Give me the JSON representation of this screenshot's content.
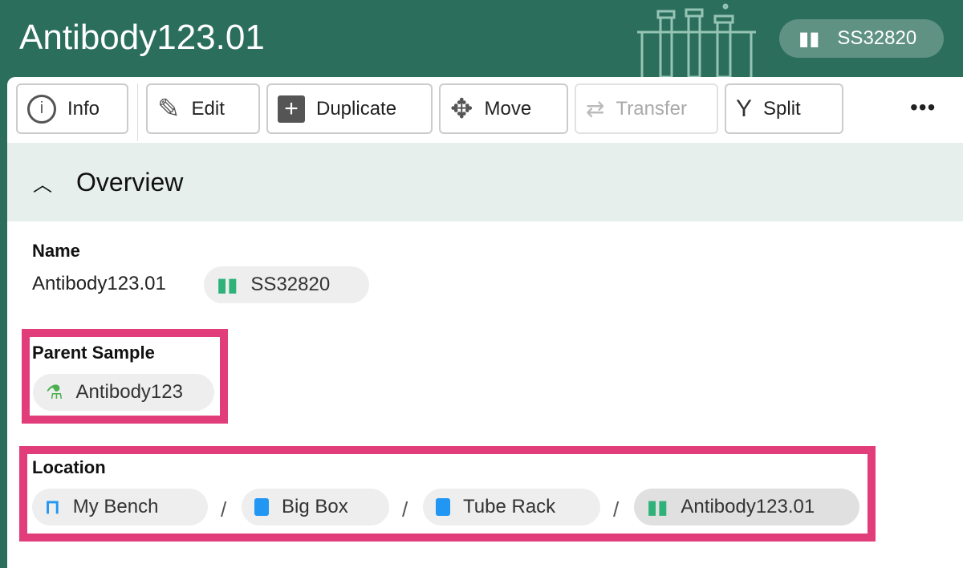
{
  "header": {
    "title": "Antibody123.01",
    "id_chip": "SS32820"
  },
  "toolbar": {
    "info": "Info",
    "edit": "Edit",
    "duplicate": "Duplicate",
    "move": "Move",
    "transfer": "Transfer",
    "split": "Split",
    "more": "•••"
  },
  "overview": {
    "title": "Overview"
  },
  "fields": {
    "name_label": "Name",
    "name_value": "Antibody123.01",
    "name_chip": "SS32820",
    "parent_label": "Parent Sample",
    "parent_chip": "Antibody123",
    "location_label": "Location",
    "location": [
      "My Bench",
      "Big Box",
      "Tube Rack",
      "Antibody123.01"
    ],
    "separator": "/"
  },
  "colors": {
    "header": "#2b6e5b",
    "highlight": "#e23d7b",
    "tube": "#2fb17a",
    "box": "#2196f3",
    "flask": "#4caf50"
  }
}
